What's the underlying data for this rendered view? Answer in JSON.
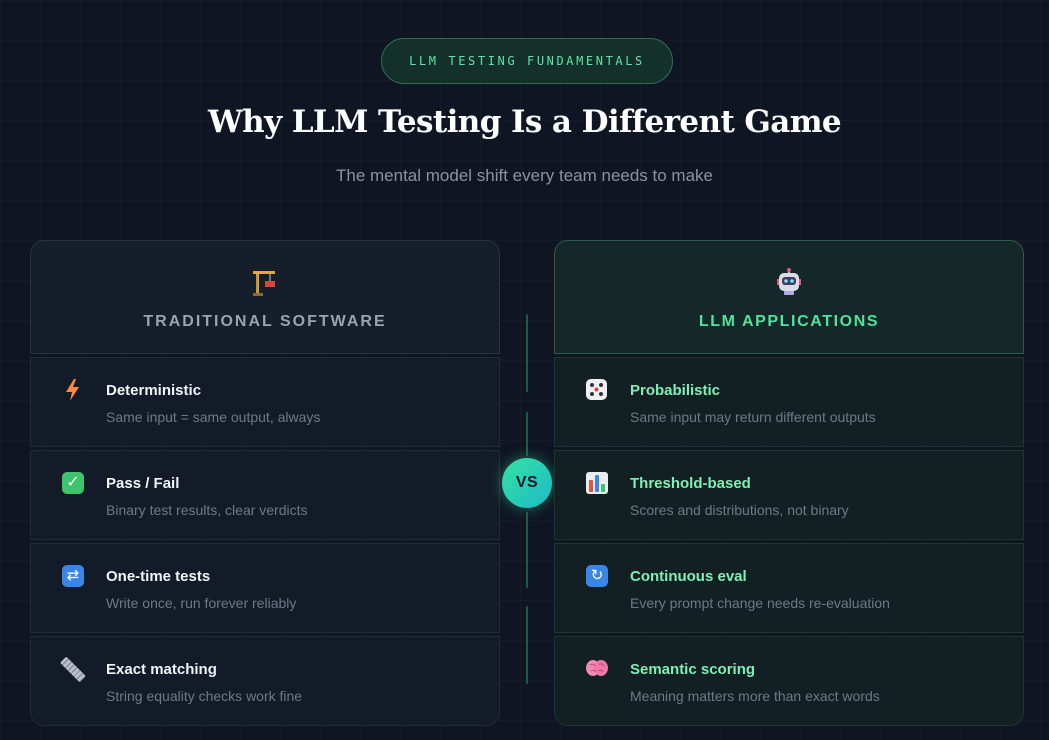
{
  "badge": "LLM TESTING FUNDAMENTALS",
  "title": "Why LLM Testing Is a Different Game",
  "subtitle": "The mental model shift every team needs to make",
  "vs_label": "VS",
  "left": {
    "label": "TRADITIONAL SOFTWARE",
    "icon": "construction-crane-icon",
    "items": [
      {
        "icon": "lightning-icon",
        "title": "Deterministic",
        "desc": "Same input = same output, always"
      },
      {
        "icon": "check-box-icon",
        "title": "Pass / Fail",
        "desc": "Binary test results, clear verdicts"
      },
      {
        "icon": "repeat-icon",
        "title": "One-time tests",
        "desc": "Write once, run forever reliably"
      },
      {
        "icon": "ruler-icon",
        "title": "Exact matching",
        "desc": "String equality checks work fine"
      }
    ]
  },
  "right": {
    "label": "LLM APPLICATIONS",
    "icon": "robot-icon",
    "items": [
      {
        "icon": "dice-icon",
        "title": "Probabilistic",
        "desc": "Same input may return different outputs"
      },
      {
        "icon": "bar-chart-icon",
        "title": "Threshold-based",
        "desc": "Scores and distributions, not binary"
      },
      {
        "icon": "refresh-icon",
        "title": "Continuous eval",
        "desc": "Every prompt change needs re-evaluation"
      },
      {
        "icon": "brain-icon",
        "title": "Semantic scoring",
        "desc": "Meaning matters more than exact words"
      }
    ]
  },
  "colors": {
    "background": "#0f1523",
    "accent_green": "#4fe39b",
    "vs_gradient_start": "#34e3a0",
    "vs_gradient_end": "#1fb9c8"
  }
}
